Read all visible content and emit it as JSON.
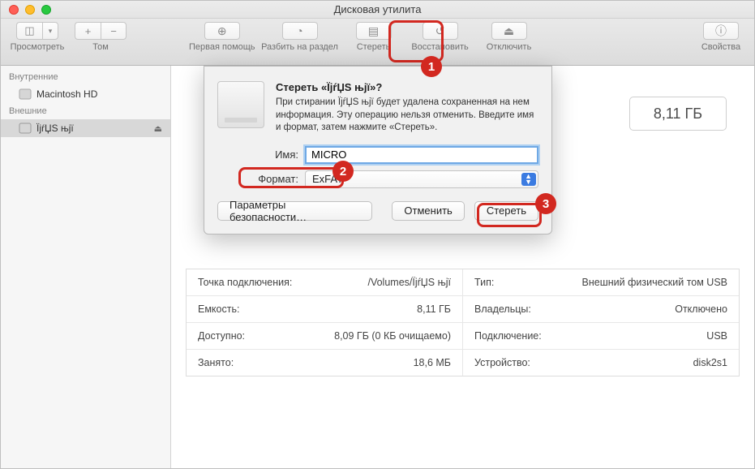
{
  "window_title": "Дисковая утилита",
  "toolbar": {
    "view": "Просмотреть",
    "volume": "Том",
    "firstaid": "Первая помощь",
    "partition": "Разбить на раздел",
    "erase": "Стереть",
    "restore": "Восстановить",
    "unmount": "Отключить",
    "info": "Свойства"
  },
  "sidebar": {
    "internal_header": "Внутренние",
    "internal_item": "Macintosh HD",
    "external_header": "Внешние",
    "external_item": "ÏjŕЏЅ њjї"
  },
  "cap_right": "8,11 ГБ",
  "sheet": {
    "title": "Стереть «ÏjŕЏЅ њjї»?",
    "text": "При стирании ÏjŕЏЅ њjї будет удалена сохраненная на нем информация. Эту операцию нельзя отменить. Введите имя и формат, затем нажмите «Стереть».",
    "name_label": "Имя:",
    "name_value": "MICRO",
    "format_label": "Формат:",
    "format_value": "ExFAT",
    "btn_security": "Параметры безопасности…",
    "btn_cancel": "Отменить",
    "btn_erase": "Стереть"
  },
  "details": {
    "rows": [
      {
        "l1": "Точка подключения:",
        "v1": "/Volumes/ÏjŕЏЅ њjї",
        "l2": "Тип:",
        "v2": "Внешний физический том USB"
      },
      {
        "l1": "Емкость:",
        "v1": "8,11 ГБ",
        "l2": "Владельцы:",
        "v2": "Отключено"
      },
      {
        "l1": "Доступно:",
        "v1": "8,09 ГБ (0 КБ очищаемо)",
        "l2": "Подключение:",
        "v2": "USB"
      },
      {
        "l1": "Занято:",
        "v1": "18,6 МБ",
        "l2": "Устройство:",
        "v2": "disk2s1"
      }
    ]
  },
  "callouts": {
    "c1": "1",
    "c2": "2",
    "c3": "3"
  }
}
